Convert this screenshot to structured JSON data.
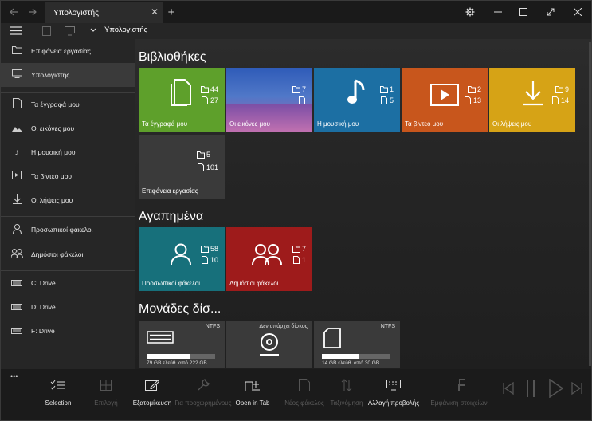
{
  "titlebar": {
    "tab_title": "Υπολογιστής",
    "new_tab": "+",
    "close_tab": "✕"
  },
  "cmdbar": {
    "path": "Υπολογιστής"
  },
  "sidebar": {
    "items": [
      {
        "label": "Επιφάνεια εργασίας",
        "icon": "folder-icon"
      },
      {
        "label": "Υπολογιστής",
        "icon": "computer-icon"
      },
      {
        "label": "Τα έγγραφά μου",
        "icon": "document-icon"
      },
      {
        "label": "Οι εικόνες μου",
        "icon": "picture-icon"
      },
      {
        "label": "Η μουσική μου",
        "icon": "music-icon"
      },
      {
        "label": "Τα βίντεό μου",
        "icon": "video-icon"
      },
      {
        "label": "Οι λήψεις μου",
        "icon": "download-icon"
      },
      {
        "label": "Προσωπικοί φάκελοι",
        "icon": "person-icon"
      },
      {
        "label": "Δημόσιοι φάκελοι",
        "icon": "people-icon"
      },
      {
        "label": "C: Drive",
        "icon": "drive-icon"
      },
      {
        "label": "D: Drive",
        "icon": "drive-icon"
      },
      {
        "label": "F: Drive",
        "icon": "drive-icon"
      }
    ]
  },
  "main": {
    "libraries_title": "Βιβλιοθήκες",
    "favorites_title": "Αγαπημένα",
    "drives_title": "Μονάδες δίσ...",
    "libraries": [
      {
        "name": "Τα έγγραφά μου",
        "folders": "44",
        "files": "27",
        "color": "#5ea02b",
        "icon": "documents-icon"
      },
      {
        "name": "Οι εικόνες μου",
        "folders": "7",
        "files": "",
        "color": "#3a6ab0",
        "icon": "picture-icon"
      },
      {
        "name": "Η μουσική μου",
        "folders": "1",
        "files": "5",
        "color": "#1c6fa3",
        "icon": "music-icon"
      },
      {
        "name": "Τα βίντεό μου",
        "folders": "2",
        "files": "13",
        "color": "#c8561c",
        "icon": "video-icon"
      },
      {
        "name": "Οι λήψεις μου",
        "folders": "9",
        "files": "14",
        "color": "#d6a316",
        "icon": "download-icon"
      },
      {
        "name": "Επιφάνεια εργασίας",
        "folders": "5",
        "files": "101",
        "color": "#3a3a3a",
        "icon": ""
      }
    ],
    "favorites": [
      {
        "name": "Προσωπικοί φάκελοι",
        "folders": "58",
        "files": "10",
        "color": "#17707b",
        "icon": "person-icon"
      },
      {
        "name": "Δημόσιοι φάκελοι",
        "folders": "7",
        "files": "1",
        "color": "#9e1b1b",
        "icon": "people-icon"
      }
    ],
    "drives": [
      {
        "fs": "NTFS",
        "info": "79 GB ελεύθ. από 222 GB",
        "used_fraction": 0.64,
        "icon": "drive-icon"
      },
      {
        "fs": "Δεν υπάρχει δίσκος",
        "info": "",
        "used_fraction": null,
        "icon": "disc-icon"
      },
      {
        "fs": "NTFS",
        "info": "14 GB ελεύθ. από 30 GB",
        "used_fraction": 0.53,
        "icon": "sdcard-icon"
      }
    ]
  },
  "bottombar": {
    "more": "•••",
    "buttons": [
      {
        "label": "Selection",
        "enabled": true,
        "icon": "selection-icon"
      },
      {
        "label": "Επιλογή",
        "enabled": false,
        "icon": "select-all-icon"
      },
      {
        "label": "Εξατομίκευση",
        "enabled": true,
        "icon": "customize-icon"
      },
      {
        "label": "Για προχωρημένους",
        "enabled": false,
        "icon": "wrench-icon"
      },
      {
        "label": "Open in Tab",
        "enabled": true,
        "icon": "open-tab-icon"
      },
      {
        "label": "Νέος φάκελος",
        "enabled": false,
        "icon": "new-folder-icon"
      },
      {
        "label": "Ταξινόμηση",
        "enabled": false,
        "icon": "sort-icon"
      },
      {
        "label": "Αλλαγή προβολής",
        "enabled": true,
        "icon": "view-icon"
      },
      {
        "label": "Εμφάνιση στοιχείων",
        "enabled": false,
        "icon": "grid-icon"
      }
    ]
  }
}
